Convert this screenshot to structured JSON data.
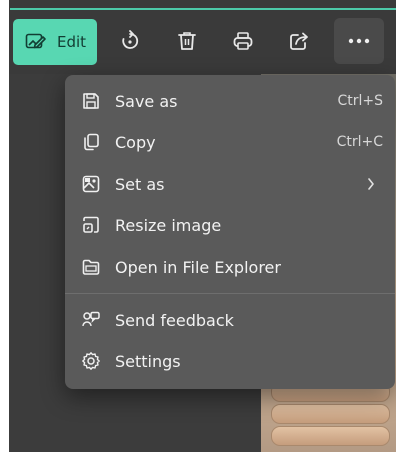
{
  "toolbar": {
    "edit_label": "Edit",
    "buttons": [
      {
        "icon": "rotate-icon"
      },
      {
        "icon": "delete-icon"
      },
      {
        "icon": "print-icon"
      },
      {
        "icon": "share-icon"
      },
      {
        "icon": "more-options-icon"
      }
    ]
  },
  "menu": {
    "items": [
      {
        "label": "Save as",
        "shortcut": "Ctrl+S",
        "icon": "save-icon"
      },
      {
        "label": "Copy",
        "shortcut": "Ctrl+C",
        "icon": "copy-icon"
      },
      {
        "label": "Set as",
        "shortcut": "",
        "icon": "set-as-icon",
        "has_submenu": true
      },
      {
        "label": "Resize image",
        "shortcut": "",
        "icon": "resize-icon"
      },
      {
        "label": "Open in File Explorer",
        "shortcut": "",
        "icon": "folder-icon"
      },
      {
        "label": "Send feedback",
        "shortcut": "",
        "icon": "feedback-icon"
      },
      {
        "label": "Settings",
        "shortcut": "",
        "icon": "gear-icon"
      }
    ]
  },
  "colors": {
    "accent": "#58d7b2",
    "toolbar_bg": "#3a3a3a",
    "menu_bg": "#5a5a5a"
  }
}
